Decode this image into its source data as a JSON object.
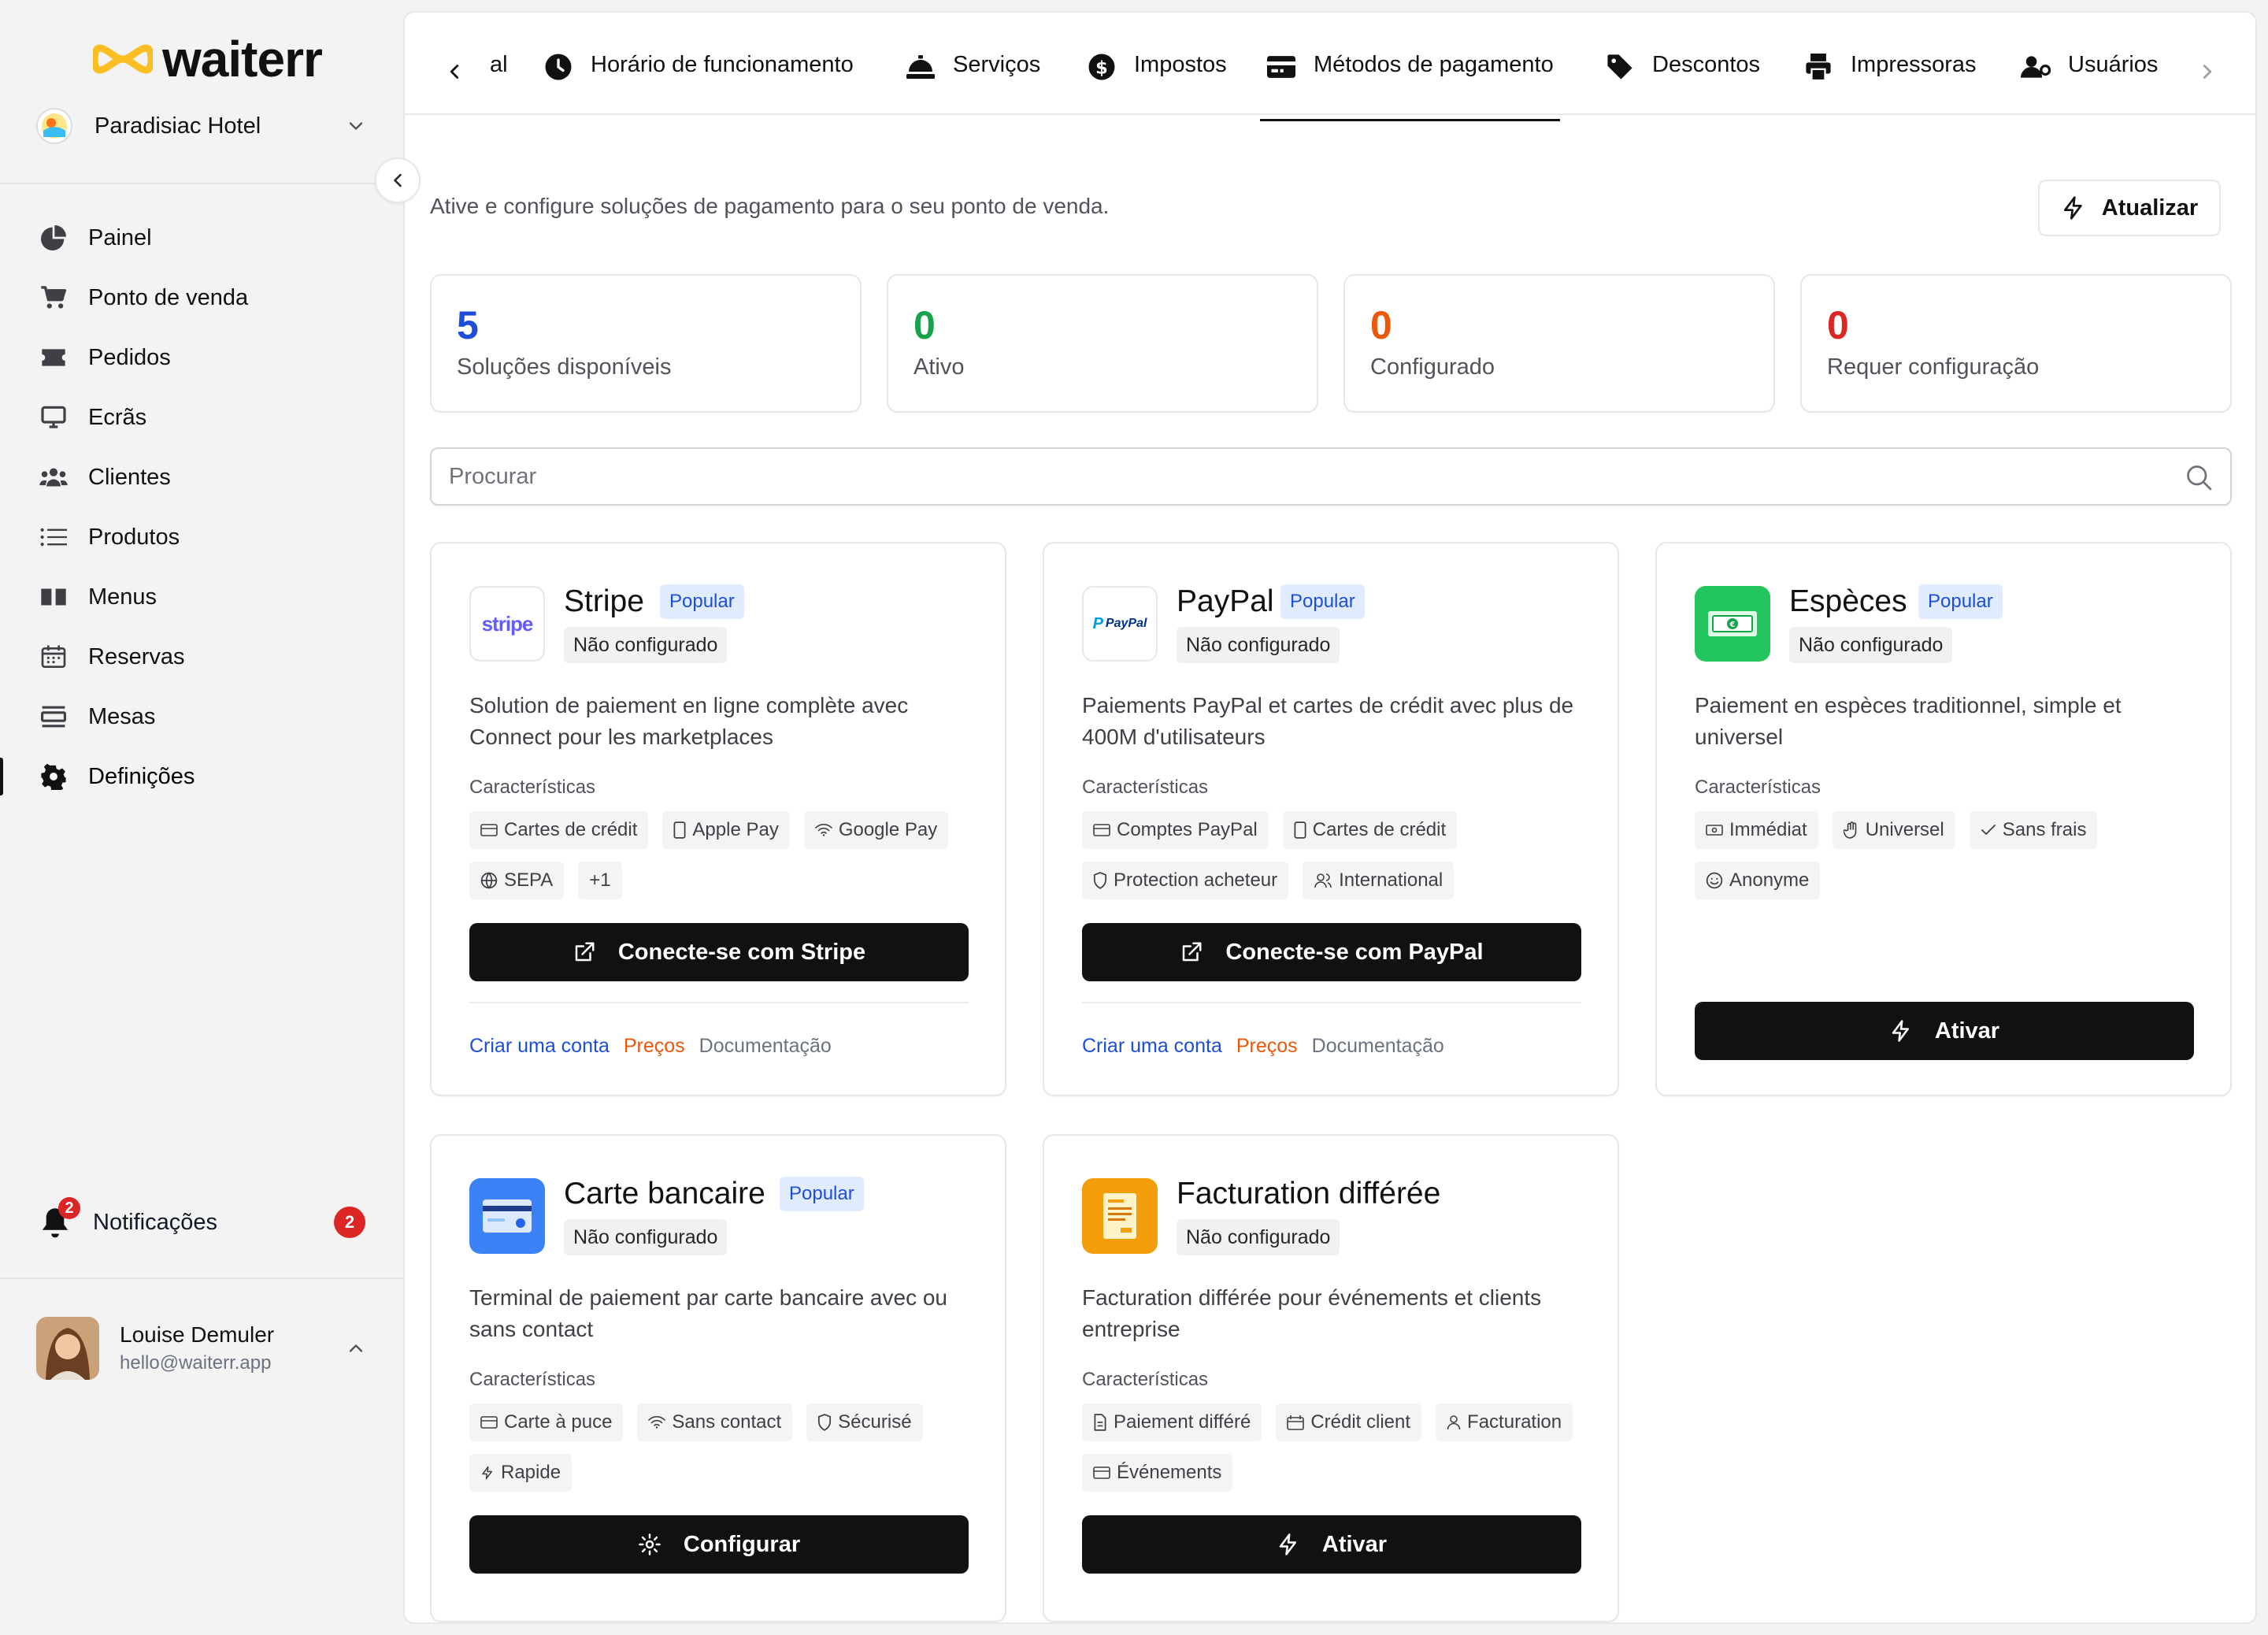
{
  "app": {
    "brand": "waiterr",
    "hotel": "Paradisiac Hotel"
  },
  "sidebar": {
    "items": [
      {
        "label": "Painel",
        "icon": "pie-chart-icon"
      },
      {
        "label": "Ponto de venda",
        "icon": "cart-icon"
      },
      {
        "label": "Pedidos",
        "icon": "ticket-icon"
      },
      {
        "label": "Ecrãs",
        "icon": "monitor-icon"
      },
      {
        "label": "Clientes",
        "icon": "users-icon"
      },
      {
        "label": "Produtos",
        "icon": "list-icon"
      },
      {
        "label": "Menus",
        "icon": "book-icon"
      },
      {
        "label": "Reservas",
        "icon": "calendar-icon"
      },
      {
        "label": "Mesas",
        "icon": "table-icon"
      },
      {
        "label": "Definições",
        "icon": "gear-icon",
        "active": true
      }
    ],
    "notifications": {
      "label": "Notificações",
      "count": "2"
    },
    "user": {
      "name": "Louise Demuler",
      "email": "hello@waiterr.app"
    }
  },
  "tabs": [
    {
      "label": "al",
      "icon": ""
    },
    {
      "label": "Horário de funcionamento",
      "icon": "clock-icon"
    },
    {
      "label": "Serviços",
      "icon": "cloche-icon"
    },
    {
      "label": "Impostos",
      "icon": "dollar-icon"
    },
    {
      "label": "Métodos de pagamento",
      "icon": "credit-card-icon",
      "active": true
    },
    {
      "label": "Descontos",
      "icon": "tag-icon"
    },
    {
      "label": "Impressoras",
      "icon": "printer-icon"
    },
    {
      "label": "Usuários",
      "icon": "user-cog-icon"
    }
  ],
  "page": {
    "subtitle": "Ative e configure soluções de pagamento para o seu ponto de venda.",
    "refresh_label": "Atualizar",
    "search_placeholder": "Procurar"
  },
  "stats": [
    {
      "value": "5",
      "label": "Soluções disponíveis",
      "color": "#1d4ed8"
    },
    {
      "value": "0",
      "label": "Ativo",
      "color": "#16a34a"
    },
    {
      "value": "0",
      "label": "Configurado",
      "color": "#ea580c"
    },
    {
      "value": "0",
      "label": "Requer configuração",
      "color": "#dc2626"
    }
  ],
  "common": {
    "features_title": "Características",
    "popular": "Popular",
    "not_configured": "Não configurado"
  },
  "cards": [
    {
      "name": "Stripe",
      "logo_text": "stripe",
      "popular": true,
      "status": "Não configurado",
      "description": "Solution de paiement en ligne complète avec Connect pour les marketplaces",
      "features": [
        {
          "label": "Cartes de crédit",
          "icon": "card-icon"
        },
        {
          "label": "Apple Pay",
          "icon": "phone-icon"
        },
        {
          "label": "Google Pay",
          "icon": "wifi-icon"
        },
        {
          "label": "SEPA",
          "icon": "globe-icon"
        },
        {
          "label": "+1",
          "icon": ""
        }
      ],
      "button": {
        "label": "Conecte-se com Stripe",
        "icon": "external-link-icon"
      },
      "links": [
        "Criar uma conta",
        "Preços",
        "Documentação"
      ]
    },
    {
      "name": "PayPal",
      "logo_text": "PayPal",
      "popular": true,
      "status": "Não configurado",
      "description": "Paiements PayPal et cartes de crédit avec plus de 400M d'utilisateurs",
      "features": [
        {
          "label": "Comptes PayPal",
          "icon": "card-icon"
        },
        {
          "label": "Cartes de crédit",
          "icon": "phone-icon"
        },
        {
          "label": "Protection acheteur",
          "icon": "shield-icon"
        },
        {
          "label": "International",
          "icon": "users-icon"
        }
      ],
      "button": {
        "label": "Conecte-se com PayPal",
        "icon": "external-link-icon"
      },
      "links": [
        "Criar uma conta",
        "Preços",
        "Documentação"
      ]
    },
    {
      "name": "Espèces",
      "logo_text": "",
      "popular": true,
      "status": "Não configurado",
      "description": "Paiement en espèces traditionnel, simple et universel",
      "features": [
        {
          "label": "Immédiat",
          "icon": "banknote-icon"
        },
        {
          "label": "Universel",
          "icon": "hand-icon"
        },
        {
          "label": "Sans frais",
          "icon": "check-icon"
        },
        {
          "label": "Anonyme",
          "icon": "smile-icon"
        }
      ],
      "button": {
        "label": "Ativar",
        "icon": "bolt-icon"
      },
      "links": []
    },
    {
      "name": "Carte bancaire",
      "logo_text": "",
      "popular": true,
      "status": "Não configurado",
      "description": "Terminal de paiement par carte bancaire avec ou sans contact",
      "features": [
        {
          "label": "Carte à puce",
          "icon": "card-icon"
        },
        {
          "label": "Sans contact",
          "icon": "wifi-icon"
        },
        {
          "label": "Sécurisé",
          "icon": "shield-icon"
        },
        {
          "label": "Rapide",
          "icon": "bolt-icon"
        }
      ],
      "button": {
        "label": "Configurar",
        "icon": "gear-icon"
      },
      "links": []
    },
    {
      "name": "Facturation différée",
      "logo_text": "",
      "popular": false,
      "status": "Não configurado",
      "description": "Facturation différée pour événements et clients entreprise",
      "features": [
        {
          "label": "Paiement différé",
          "icon": "file-icon"
        },
        {
          "label": "Crédit client",
          "icon": "wallet-icon"
        },
        {
          "label": "Facturation",
          "icon": "user-icon"
        },
        {
          "label": "Événements",
          "icon": "card-icon"
        }
      ],
      "button": {
        "label": "Ativar",
        "icon": "bolt-icon"
      },
      "links": []
    }
  ]
}
